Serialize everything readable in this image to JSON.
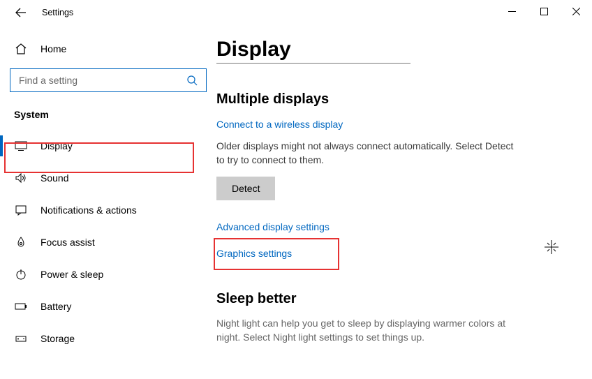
{
  "window": {
    "title": "Settings"
  },
  "sidebar": {
    "home": "Home",
    "search_placeholder": "Find a setting",
    "group": "System",
    "items": [
      {
        "label": "Display"
      },
      {
        "label": "Sound"
      },
      {
        "label": "Notifications & actions"
      },
      {
        "label": "Focus assist"
      },
      {
        "label": "Power & sleep"
      },
      {
        "label": "Battery"
      },
      {
        "label": "Storage"
      }
    ]
  },
  "page": {
    "title": "Display",
    "multi_h": "Multiple displays",
    "connect_link": "Connect to a wireless display",
    "detect_desc": "Older displays might not always connect automatically. Select Detect to try to connect to them.",
    "detect_btn": "Detect",
    "adv_link": "Advanced display settings",
    "gfx_link": "Graphics settings",
    "sleep_h": "Sleep better",
    "sleep_desc": "Night light can help you get to sleep by displaying warmer colors at night. Select Night light settings to set things up."
  }
}
